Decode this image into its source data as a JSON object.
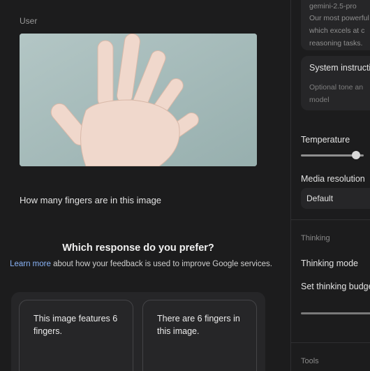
{
  "chat": {
    "role_label": "User",
    "prompt": "How many fingers are in this image",
    "preference": {
      "title": "Which response do you prefer?",
      "learn_more": "Learn more",
      "info_rest": " about how your feedback is used to improve Google services."
    },
    "responses": [
      {
        "text": "This image features 6 fingers."
      },
      {
        "text": "There are 6 fingers in this image."
      }
    ]
  },
  "settings": {
    "model": {
      "name": "gemini-2.5-pro",
      "description_lines": [
        "Our most powerful",
        "which excels at c",
        "reasoning tasks."
      ]
    },
    "system_instructions": {
      "title": "System instructions",
      "placeholder_lines": [
        "Optional tone an",
        "model"
      ]
    },
    "temperature": {
      "label": "Temperature",
      "value_fraction": 0.92
    },
    "media_resolution": {
      "label": "Media resolution",
      "selected": "Default"
    },
    "thinking": {
      "section": "Thinking",
      "mode_label": "Thinking mode",
      "budget_label": "Set thinking budget"
    },
    "tools": {
      "section": "Tools"
    }
  },
  "colors": {
    "background": "#1c1c1d",
    "card": "#262628",
    "link": "#8ab4f8",
    "image_bg": "#a6bcbb"
  },
  "icons": {
    "slider_thumb": "circle"
  }
}
